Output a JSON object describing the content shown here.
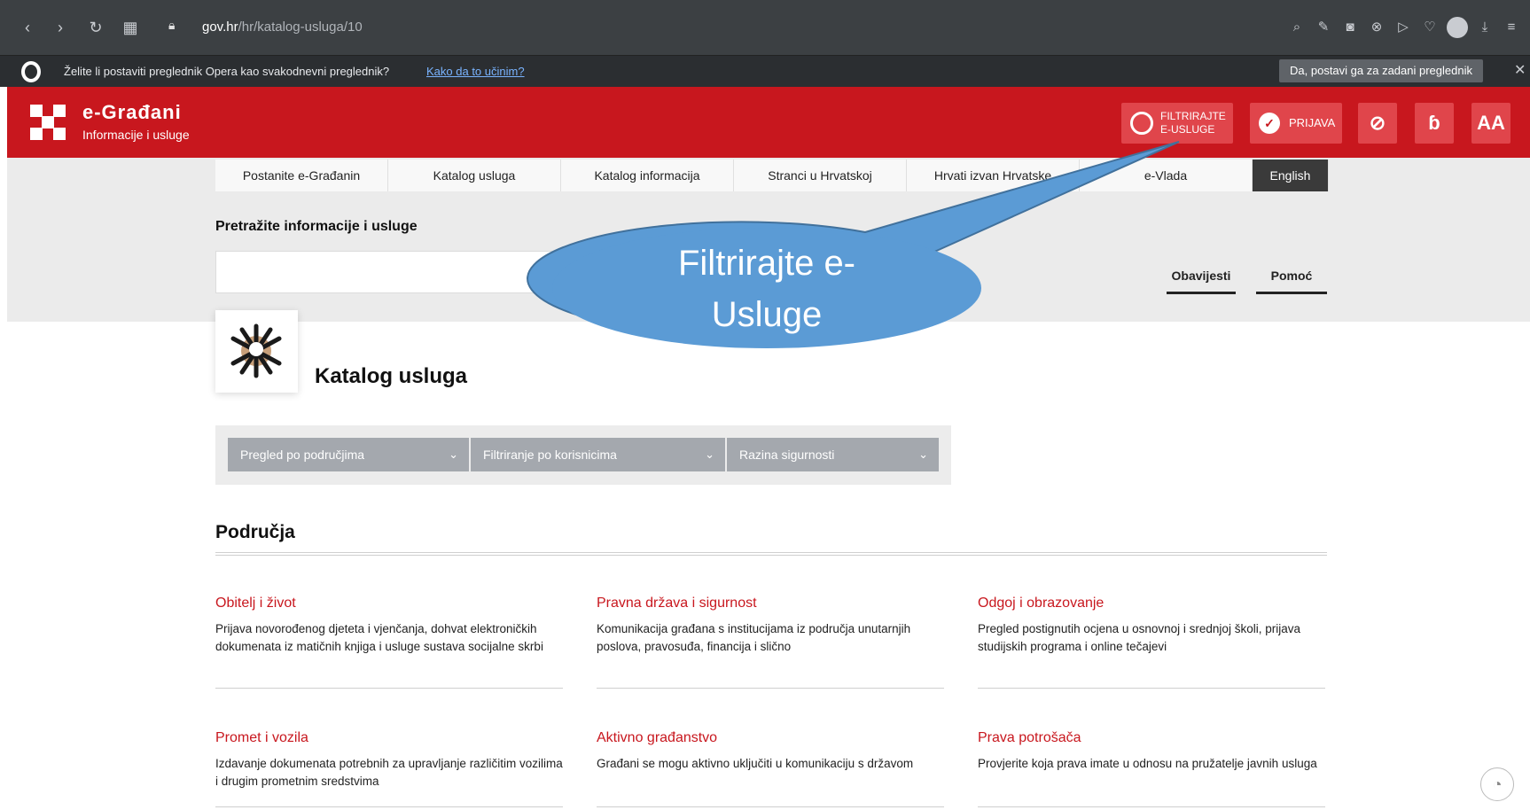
{
  "browser": {
    "url_host": "gov.hr",
    "url_path": "/hr/katalog-usluga/10",
    "infobar_text": "Želite li postaviti preglednik Opera kao svakodnevni preglednik?",
    "infobar_link": "Kako da to učinim?",
    "infobar_button": "Da, postavi ga za zadani preglednik",
    "icons": [
      "back-icon",
      "forward-icon",
      "reload-icon",
      "speed-dial-icon",
      "lock-icon",
      "search-icon",
      "edit-icon",
      "camera-icon",
      "block-icon",
      "send-icon",
      "heart-icon",
      "profile-icon",
      "download-icon",
      "menu-icon",
      "close-icon"
    ]
  },
  "header": {
    "title": "e-Građani",
    "subtitle": "Informacije i usluge",
    "filter_line1": "FILTRIRAJTE",
    "filter_line2": "E-USLUGE",
    "login_label": "PRIJAVA",
    "font_icon_glyph": "ɓ",
    "size_icon_glyph": "AA",
    "brand_color": "#c8171e"
  },
  "nav": {
    "items": [
      "Postanite e-Građanin",
      "Katalog usluga",
      "Katalog informacija",
      "Stranci u Hrvatskoj",
      "Hrvati izvan Hrvatske",
      "e-Vlada"
    ],
    "english": "English"
  },
  "search": {
    "label": "Pretražite informacije i usluge",
    "value": ""
  },
  "tabs": {
    "notices": "Obavijesti",
    "help": "Pomoć"
  },
  "catalog": {
    "title": "Katalog usluga"
  },
  "filters": {
    "areas": "Pregled po područjima",
    "users": "Filtriranje po korisnicima",
    "security": "Razina sigurnosti"
  },
  "section": {
    "title": "Područja"
  },
  "areas": [
    {
      "title": "Obitelj i život",
      "desc": "Prijava novorođenog djeteta i vjenčanja, dohvat elektroničkih dokumenata iz matičnih knjiga i usluge sustava socijalne skrbi"
    },
    {
      "title": "Pravna država i sigurnost",
      "desc": "Komunikacija građana s institucijama iz područja unutarnjih poslova, pravosuđa, financija i slično"
    },
    {
      "title": "Odgoj i obrazovanje",
      "desc": "Pregled postignutih ocjena u osnovnoj i srednjoj školi, prijava studijskih programa i online tečajevi"
    },
    {
      "title": "Promet i vozila",
      "desc": "Izdavanje dokumenata potrebnih za upravljanje različitim vozilima i drugim prometnim sredstvima"
    },
    {
      "title": "Aktivno građanstvo",
      "desc": "Građani se mogu aktivno uključiti u komunikaciju s državom"
    },
    {
      "title": "Prava potrošača",
      "desc": "Provjerite koja prava imate u odnosu na pružatelje javnih usluga"
    }
  ],
  "callout": {
    "line1": "Filtrirajte e-",
    "line2": "Usluge",
    "fill": "#5b9bd5"
  }
}
